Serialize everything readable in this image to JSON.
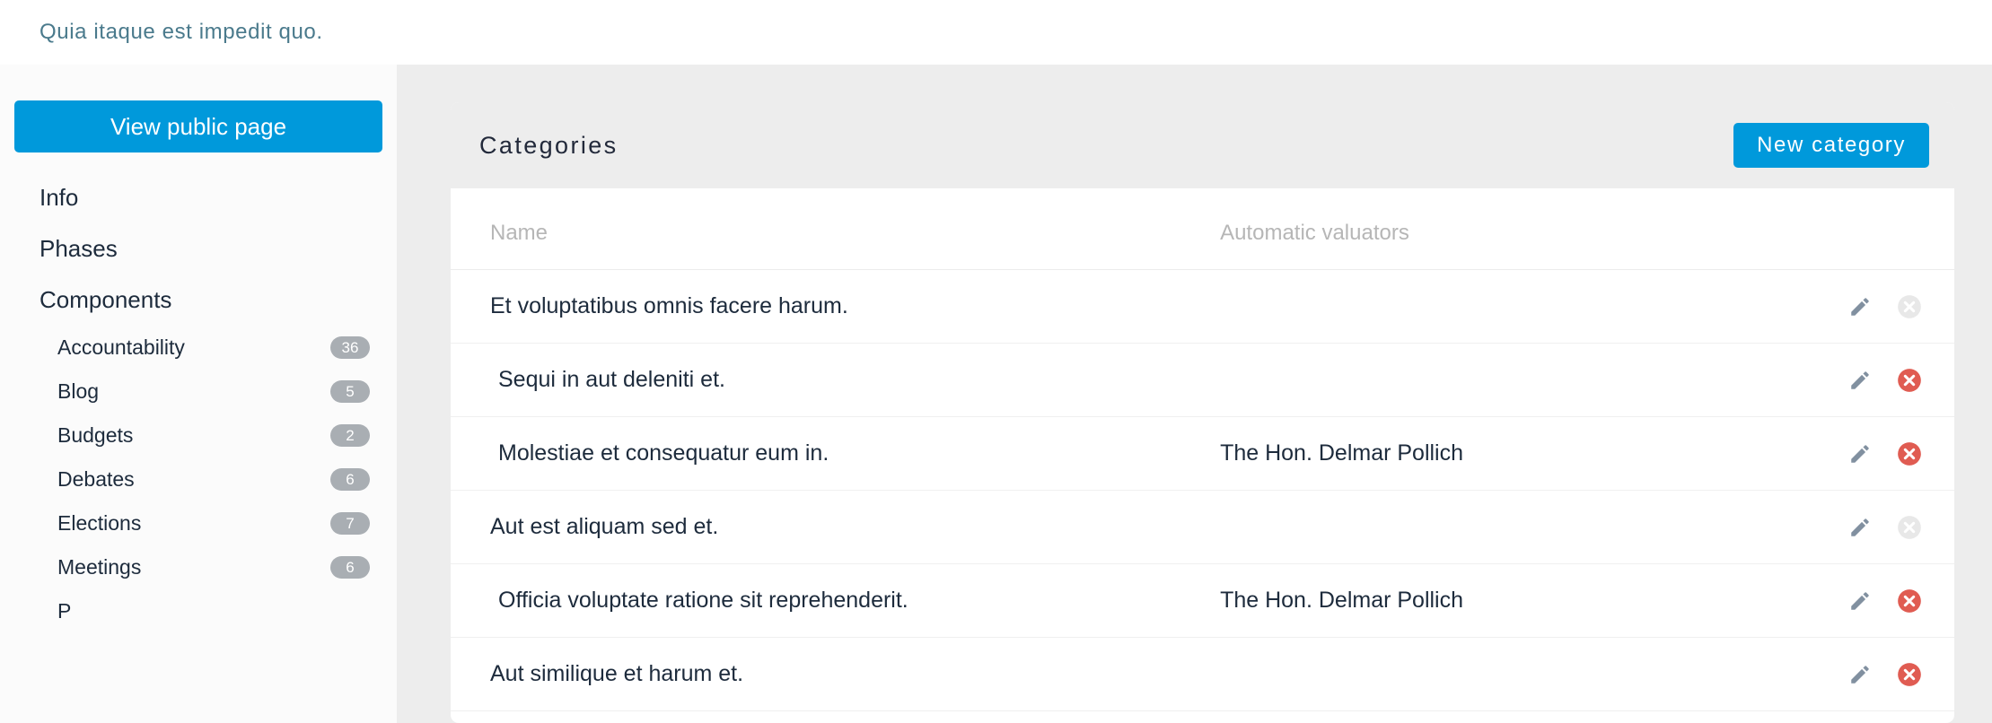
{
  "topbar": {
    "title": "Quia itaque est impedit quo."
  },
  "sidebar": {
    "public_page_button": "View public page",
    "nav_items": [
      {
        "label": "Info"
      },
      {
        "label": "Phases"
      },
      {
        "label": "Components"
      }
    ],
    "components": [
      {
        "label": "Accountability",
        "count": "36"
      },
      {
        "label": "Blog",
        "count": "5"
      },
      {
        "label": "Budgets",
        "count": "2"
      },
      {
        "label": "Debates",
        "count": "6"
      },
      {
        "label": "Elections",
        "count": "7"
      },
      {
        "label": "Meetings",
        "count": "6"
      },
      {
        "label": "P",
        "count": ""
      }
    ]
  },
  "main": {
    "card_title": "Categories",
    "new_category_button": "New category",
    "columns": {
      "name": "Name",
      "automatic_valuators": "Automatic valuators"
    },
    "rows": [
      {
        "name": "Et voluptatibus omnis facere harum.",
        "valuators": "",
        "indent": 0,
        "edit_icon": "pencil-icon",
        "delete_icon": "x-circle-icon",
        "delete_enabled": false
      },
      {
        "name": "Sequi in aut deleniti et.",
        "valuators": "",
        "indent": 1,
        "edit_icon": "pencil-icon",
        "delete_icon": "x-circle-icon",
        "delete_enabled": true
      },
      {
        "name": "Molestiae et consequatur eum in.",
        "valuators": "The Hon. Delmar Pollich",
        "indent": 1,
        "edit_icon": "pencil-icon",
        "delete_icon": "x-circle-icon",
        "delete_enabled": true
      },
      {
        "name": "Aut est aliquam sed et.",
        "valuators": "",
        "indent": 0,
        "edit_icon": "pencil-icon",
        "delete_icon": "x-circle-icon",
        "delete_enabled": false
      },
      {
        "name": "Officia voluptate ratione sit reprehenderit.",
        "valuators": "The Hon. Delmar Pollich",
        "indent": 1,
        "edit_icon": "pencil-icon",
        "delete_icon": "x-circle-icon",
        "delete_enabled": true
      },
      {
        "name": "Aut similique et harum et.",
        "valuators": "",
        "indent": 0,
        "edit_icon": "pencil-icon",
        "delete_icon": "x-circle-icon",
        "delete_enabled": true
      }
    ]
  },
  "colors": {
    "accent_blue": "#0099db",
    "title_teal": "#4a7a8c",
    "badge_gray": "#a9aeb3",
    "delete_red": "#e05c52",
    "delete_disabled": "#e8e8e8",
    "pencil_gray": "#8190a0",
    "page_bg": "#ededed",
    "sidebar_bg": "#fbfbfb"
  }
}
